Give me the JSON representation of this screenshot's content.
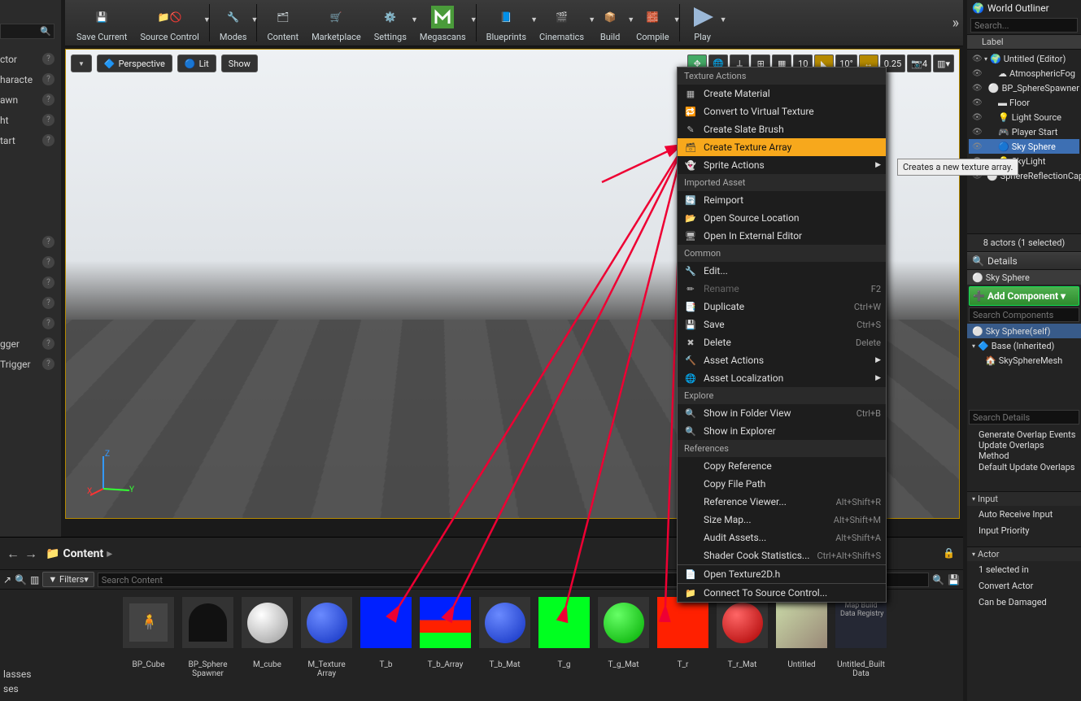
{
  "toolbar": {
    "save": "Save Current",
    "source": "Source Control",
    "modes": "Modes",
    "content": "Content",
    "market": "Marketplace",
    "settings": "Settings",
    "mega": "Megascans",
    "bp": "Blueprints",
    "cine": "Cinematics",
    "build": "Build",
    "compile": "Compile",
    "play": "Play"
  },
  "viewport": {
    "persp": "Perspective",
    "lit": "Lit",
    "show": "Show",
    "snap1": "10",
    "snap_deg": "10°",
    "snap_sc": "0.25",
    "cam": "4",
    "axes": {
      "x": "X",
      "y": "Y",
      "z": "Z"
    }
  },
  "leftp": {
    "actor": "ctor",
    "character": "haracte",
    "pawn": "awn",
    "light": "ht",
    "start": "tart",
    "trigger": "gger",
    "ptrigger": "Trigger",
    "classes": "lasses",
    "ses": "ses"
  },
  "ctx": {
    "h1": "Texture Actions",
    "create_mat": "Create Material",
    "conv_vt": "Convert to Virtual Texture",
    "slate": "Create Slate Brush",
    "tarray": "Create Texture Array",
    "sprite": "Sprite Actions",
    "h2": "Imported Asset",
    "reimport": "Reimport",
    "opensrc": "Open Source Location",
    "openext": "Open In External Editor",
    "h3": "Common",
    "edit": "Edit...",
    "rename": "Rename",
    "dup": "Duplicate",
    "save": "Save",
    "del": "Delete",
    "assetact": "Asset Actions",
    "assetloc": "Asset Localization",
    "h4": "Explore",
    "showfolder": "Show in Folder View",
    "showexp": "Show in Explorer",
    "h5": "References",
    "cref": "Copy Reference",
    "cpath": "Copy File Path",
    "refv": "Reference Viewer...",
    "sizemap": "Size Map...",
    "audit": "Audit Assets...",
    "shader": "Shader Cook Statistics...",
    "opent": "Open Texture2D.h",
    "srcctrl": "Connect To Source Control...",
    "s_rename": "F2",
    "s_dup": "Ctrl+W",
    "s_save": "Ctrl+S",
    "s_del": "Delete",
    "s_showf": "Ctrl+B",
    "s_ref": "Alt+Shift+R",
    "s_size": "Alt+Shift+M",
    "s_audit": "Alt+Shift+A",
    "s_shader": "Ctrl+Alt+Shift+S"
  },
  "tooltip": "Creates a new texture array.",
  "outliner": {
    "title": "World Outliner",
    "search": "Search...",
    "label": "Label",
    "root": "Untitled (Editor)",
    "items": [
      "AtmosphericFog",
      "BP_SphereSpawner",
      "Floor",
      "Light Source",
      "Player Start",
      "Sky Sphere",
      "SkyLight",
      "SphereReflectionCapture"
    ],
    "status": "8 actors (1 selected)"
  },
  "details": {
    "title": "Details",
    "object": "Sky Sphere",
    "addcomp": "Add Component",
    "search_comp": "Search Components",
    "root": "Sky Sphere(self)",
    "base": "Base (Inherited)",
    "mesh": "SkySphereMesh",
    "search_det": "Search Details",
    "def": [
      "Generate Overlap Events",
      "Update Overlaps Method",
      "Default Update Overlaps"
    ],
    "input": "Input",
    "i1": "Auto Receive Input",
    "i2": "Input Priority",
    "actor": "Actor",
    "a1": "1 selected in",
    "a2": "Convert Actor",
    "a3": "Can be Damaged"
  },
  "cb": {
    "path": "Content",
    "filters": "Filters",
    "search": "Search Content",
    "assets": [
      {
        "n": "BP_Cube"
      },
      {
        "n": "BP_Sphere\nSpawner"
      },
      {
        "n": "M_cube"
      },
      {
        "n": "M_Texture\nArray"
      },
      {
        "n": "T_b"
      },
      {
        "n": "T_b_Array"
      },
      {
        "n": "T_b_Mat"
      },
      {
        "n": "T_g"
      },
      {
        "n": "T_g_Mat"
      },
      {
        "n": "T_r"
      },
      {
        "n": "T_r_Mat"
      },
      {
        "n": "Untitled"
      },
      {
        "n": "Untitled_Built\nData"
      }
    ],
    "data_reg": "Map Build\nData Registry"
  }
}
